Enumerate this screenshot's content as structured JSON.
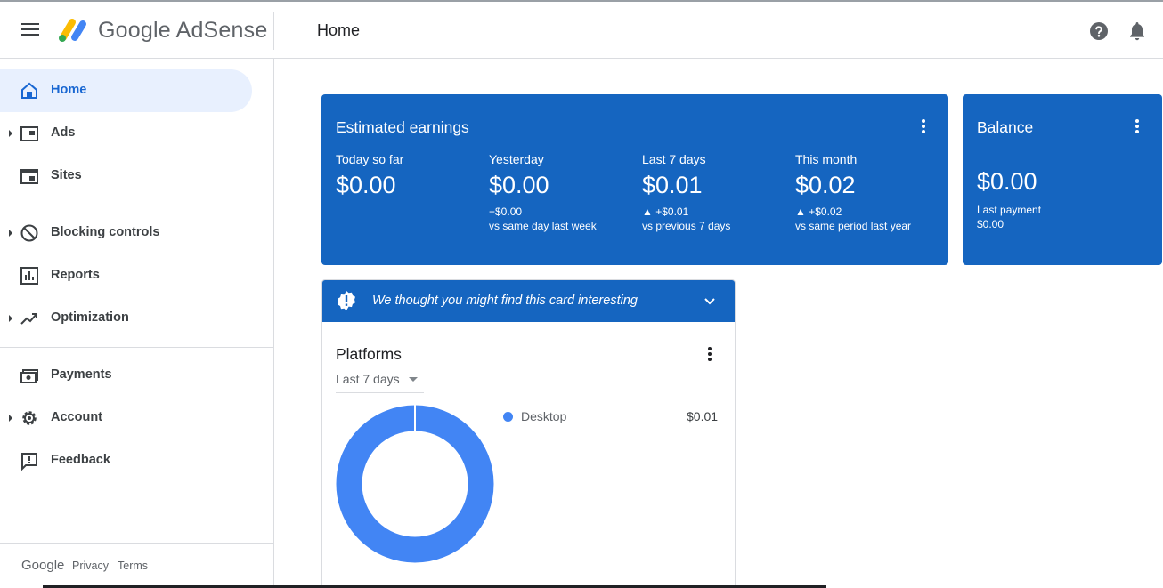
{
  "header": {
    "menu_icon": "hamburger-menu-icon",
    "logo_text": "Google AdSense",
    "page_title": "Home",
    "help_icon": "help-icon",
    "notifications_icon": "bell-icon"
  },
  "sidebar": {
    "items": [
      {
        "label": "Home",
        "icon": "home-icon",
        "active": true
      },
      {
        "label": "Ads",
        "icon": "ads-icon"
      },
      {
        "label": "Sites",
        "icon": "sites-icon"
      },
      {
        "label": "Blocking controls",
        "icon": "block-icon"
      },
      {
        "label": "Reports",
        "icon": "reports-icon"
      },
      {
        "label": "Optimization",
        "icon": "trending-up-icon"
      },
      {
        "label": "Payments",
        "icon": "payments-icon"
      },
      {
        "label": "Account",
        "icon": "gear-icon"
      },
      {
        "label": "Feedback",
        "icon": "feedback-icon"
      }
    ],
    "footer": {
      "brand": "Google",
      "privacy": "Privacy",
      "terms": "Terms"
    }
  },
  "earnings": {
    "title": "Estimated earnings",
    "metrics": [
      {
        "label": "Today so far",
        "value": "$0.00",
        "delta": "",
        "comparison": ""
      },
      {
        "label": "Yesterday",
        "value": "$0.00",
        "delta": "+$0.00",
        "comparison": "vs same day last week"
      },
      {
        "label": "Last 7 days",
        "value": "$0.01",
        "delta": "▲ +$0.01",
        "comparison": "vs previous 7 days"
      },
      {
        "label": "This month",
        "value": "$0.02",
        "delta": "▲ +$0.02",
        "comparison": "vs same period last year"
      }
    ]
  },
  "balance": {
    "title": "Balance",
    "value": "$0.00",
    "last_payment_label": "Last payment",
    "last_payment_value": "$0.00"
  },
  "insight": {
    "text": "We thought you might find this card interesting"
  },
  "platforms": {
    "title": "Platforms",
    "range": "Last 7 days",
    "legend": [
      {
        "name": "Desktop",
        "value": "$0.01",
        "color": "#4285f4"
      }
    ]
  },
  "chart_data": {
    "type": "pie",
    "categories": [
      "Desktop"
    ],
    "values": [
      0.01
    ],
    "title": "Platforms"
  },
  "colors": {
    "primary": "#1565c0",
    "accent": "#1967d2",
    "active_bg": "#e8f0fe",
    "donut": "#4285f4"
  }
}
